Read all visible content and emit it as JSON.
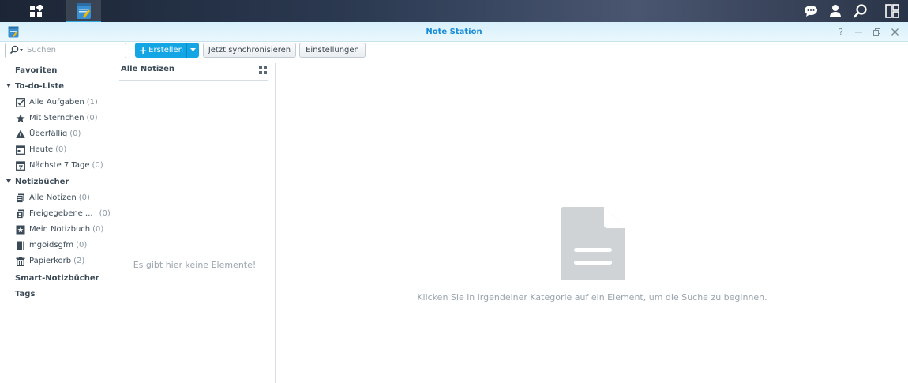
{
  "window": {
    "title": "Note Station"
  },
  "toolbar": {
    "search_placeholder": "Suchen",
    "create_label": "Erstellen",
    "sync_label": "Jetzt synchronisieren",
    "settings_label": "Einstellungen"
  },
  "sidebar": {
    "favorites": "Favoriten",
    "todo_header": "To-do-Liste",
    "todo_items": [
      {
        "label": "Alle Aufgaben",
        "count": "(1)",
        "icon": "checkbox-icon"
      },
      {
        "label": "Mit Sternchen",
        "count": "(0)",
        "icon": "star-icon"
      },
      {
        "label": "Überfällig",
        "count": "(0)",
        "icon": "warning-icon"
      },
      {
        "label": "Heute",
        "count": "(0)",
        "icon": "calendar-today-icon"
      },
      {
        "label": "Nächste 7 Tage",
        "count": "(0)",
        "icon": "calendar-week-icon"
      }
    ],
    "notebooks_header": "Notizbücher",
    "notebook_items": [
      {
        "label": "Alle Notizen",
        "count": "(0)",
        "icon": "notes-stack-icon"
      },
      {
        "label": "Freigegebene ...",
        "count": "(0)",
        "icon": "shared-notes-icon"
      },
      {
        "label": "Mein Notizbuch",
        "count": "(0)",
        "icon": "notebook-star-icon"
      },
      {
        "label": "mgoidsgfm",
        "count": "(0)",
        "icon": "notebook-icon"
      },
      {
        "label": "Papierkorb",
        "count": "(2)",
        "icon": "trash-icon"
      }
    ],
    "smart_notebooks": "Smart-Notizbücher",
    "tags": "Tags"
  },
  "notelist": {
    "title": "Alle Notizen",
    "empty_message": "Es gibt hier keine Elemente!"
  },
  "main": {
    "hint": "Klicken Sie in irgendeiner Kategorie auf ein Element, um die Suche zu beginnen."
  }
}
